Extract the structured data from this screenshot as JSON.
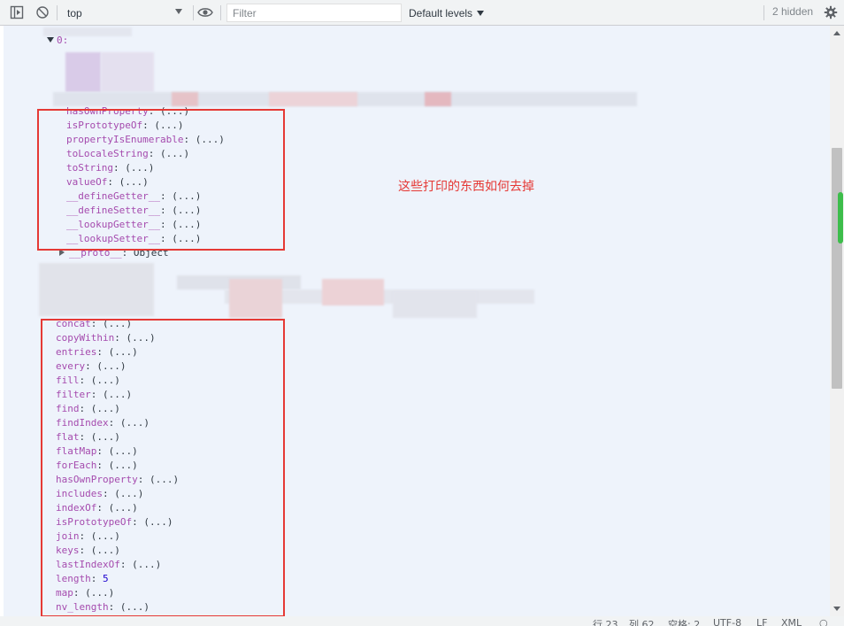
{
  "toolbar": {
    "context": "top",
    "filter_placeholder": "Filter",
    "levels_label": "Default levels",
    "hidden_label": "2 hidden",
    "icons": [
      "sidebar-toggle-icon",
      "clear-console-icon",
      "eye-icon",
      "gear-icon"
    ]
  },
  "tree": {
    "index_label": "0:",
    "proto_label": "__proto__",
    "proto_value": "Object",
    "object_methods": [
      "hasOwnProperty",
      "isPrototypeOf",
      "propertyIsEnumerable",
      "toLocaleString",
      "toString",
      "valueOf",
      "__defineGetter__",
      "__defineSetter__",
      "__lookupGetter__",
      "__lookupSetter__"
    ],
    "array_methods": [
      "concat",
      "copyWithin",
      "entries",
      "every",
      "fill",
      "filter",
      "find",
      "findIndex",
      "flat",
      "flatMap",
      "forEach",
      "hasOwnProperty",
      "includes",
      "indexOf",
      "isPrototypeOf",
      "join",
      "keys",
      "lastIndexOf",
      "length",
      "map",
      "nv_length"
    ],
    "getter_value": "(...)",
    "length_value": "5"
  },
  "annotation": "这些打印的东西如何去掉",
  "statusbar": {
    "row": "行 23",
    "col": "列 62",
    "spaces": "空格: 2",
    "encoding": "UTF-8",
    "eol": "LF",
    "language": "XML"
  },
  "colors": {
    "highlight_box": "#e53935",
    "key": "#a54bae",
    "number": "#1c00cf"
  }
}
